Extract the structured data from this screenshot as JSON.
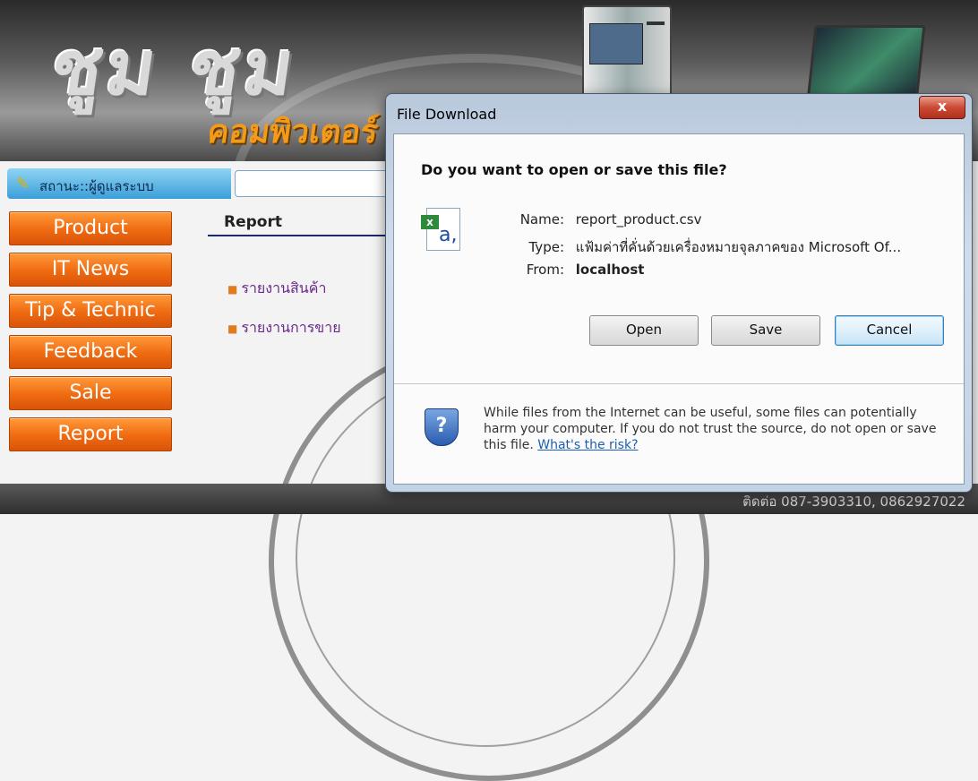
{
  "site": {
    "logo_text": "ชูม ชูม",
    "logo_sub": "คอมพิวเตอร์",
    "status_label": "สถานะ::ผู้ดูแลระบบ",
    "menu": [
      {
        "label": "Product"
      },
      {
        "label": "IT News"
      },
      {
        "label": "Tip & Technic"
      },
      {
        "label": "Feedback"
      },
      {
        "label": "Sale"
      },
      {
        "label": "Report"
      }
    ],
    "report_title": "Report",
    "report_links": [
      "รายงานสินค้า",
      "รายงานการขาย"
    ],
    "footer_contact": "ติดต่อ 087-3903310, 0862927022"
  },
  "dialog": {
    "title": "File Download",
    "close_label": "x",
    "question": "Do you want to open or save this file?",
    "name_label": "Name:",
    "name_value": "report_product.csv",
    "type_label": "Type:",
    "type_value": "แฟ้มค่าที่คั่นด้วยเครื่องหมายจุลภาคของ Microsoft Of...",
    "from_label": "From:",
    "from_value": "localhost",
    "open_label": "Open",
    "save_label": "Save",
    "cancel_label": "Cancel",
    "warning_text": "While files from the Internet can be useful, some files can potentially harm your computer. If you do not trust the source, do not open or save this file.",
    "risk_link": "What's the risk?"
  },
  "icons": {
    "file_icon": "csv-excel-file-icon",
    "shield_icon": "security-shield-question-icon"
  }
}
